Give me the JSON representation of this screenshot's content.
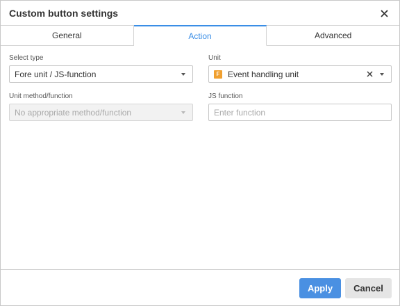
{
  "dialog": {
    "title": "Custom button settings",
    "close_icon": "close-icon"
  },
  "tabs": [
    {
      "label": "General",
      "active": false
    },
    {
      "label": "Action",
      "active": true
    },
    {
      "label": "Advanced",
      "active": false
    }
  ],
  "form": {
    "select_type": {
      "label": "Select type",
      "value": "Fore unit / JS-function"
    },
    "unit": {
      "label": "Unit",
      "value": "Event handling unit",
      "icon_letter": "F"
    },
    "unit_method": {
      "label": "Unit method/function",
      "value": "No appropriate method/function",
      "disabled": true
    },
    "js_function": {
      "label": "JS function",
      "placeholder": "Enter function",
      "value": ""
    }
  },
  "footer": {
    "apply_label": "Apply",
    "cancel_label": "Cancel"
  },
  "colors": {
    "accent": "#3a8ee6",
    "apply_bg": "#4a90e2",
    "cancel_bg": "#e5e5e5",
    "unit_icon": "#f0a030"
  }
}
